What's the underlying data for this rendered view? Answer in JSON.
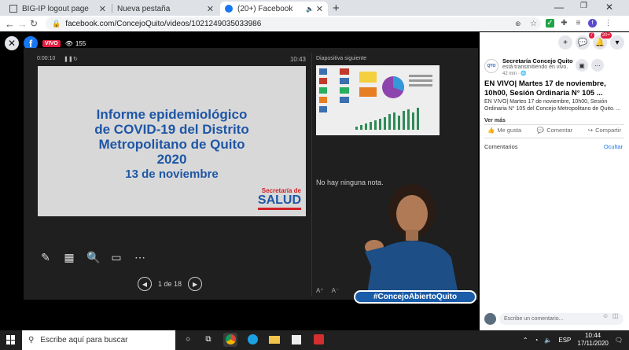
{
  "browser": {
    "tabs": [
      {
        "title": "BIG-IP logout page"
      },
      {
        "title": "Nueva pestaña"
      },
      {
        "title": "(20+) Facebook"
      }
    ],
    "url": "facebook.com/ConcejoQuito/videos/1021249035033986"
  },
  "video": {
    "live_label": "VIVO",
    "viewers": "155",
    "presenter_view": {
      "elapsed": "0:00:10",
      "clock": "10:43",
      "next_slide_label": "Diapositiva siguiente",
      "notes_text": "No hay ninguna nota.",
      "page_indicator": "1 de 18"
    },
    "slide": {
      "title_lines": [
        "Informe epidemiológico",
        "de COVID-19 del Distrito",
        "Metropolitano de Quito",
        "2020"
      ],
      "date_line": "13 de noviembre",
      "logo_top": "Secretaría de",
      "logo_main": "SALUD"
    },
    "hashtag": "#ConcejoAbiertoQuito"
  },
  "panel": {
    "notification_badges": {
      "messenger": "7",
      "notifications": "20+"
    },
    "page_name": "Secretaría Concejo Quito",
    "page_status": "está transmitiendo en vivo.",
    "page_time": "42 min · ",
    "post_title": "EN VIVO| Martes 17 de noviembre, 10h00, Sesión Ordinaria N° 105 ...",
    "post_desc": "EN VIVO| Martes 17 de noviembre, 10h00, Sesión Ordinaria N° 105 del Concejo Metropolitano de Quito. ...",
    "ver_mas": "Ver más",
    "actions": {
      "like": "Me gusta",
      "comment": "Comentar",
      "share": "Compartir"
    },
    "comments_header": "Comentarios",
    "hide_label": "Ocultar",
    "comment_placeholder": "Escribe un comentario..."
  },
  "taskbar": {
    "search_placeholder": "Escribe aquí para buscar",
    "language": "ESP",
    "time": "10:44",
    "date": "17/11/2020"
  }
}
